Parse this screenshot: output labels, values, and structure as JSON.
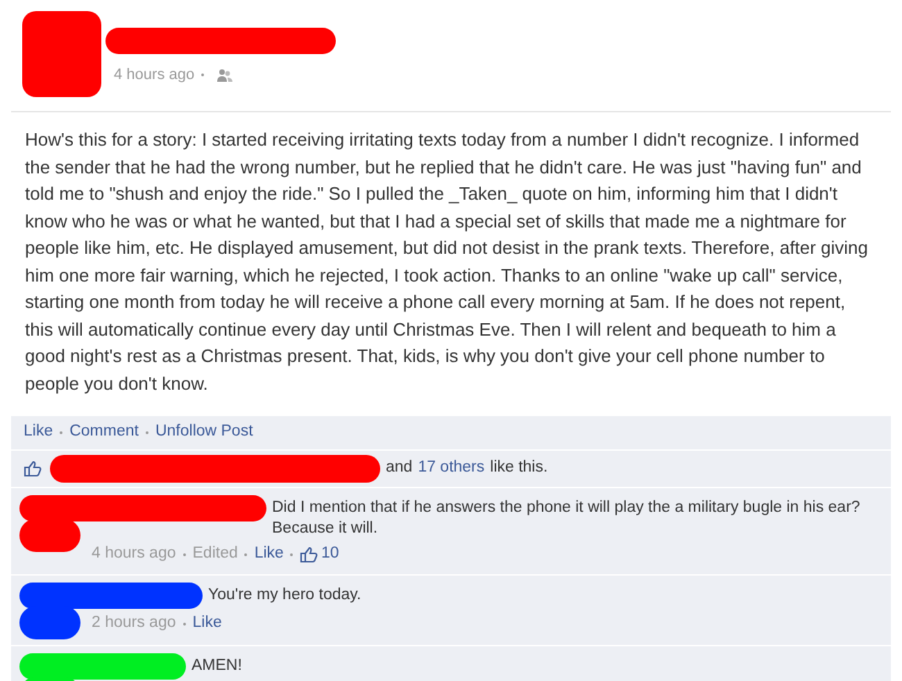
{
  "post": {
    "time": "4 hours ago",
    "text": "How's this for a story: I started receiving irritating texts today from a number I didn't recognize. I informed the sender that he had the wrong number, but he replied that he didn't care. He was just \"having fun\" and told me to \"shush and enjoy the ride.\" So I pulled the _Taken_ quote on him, informing him that I didn't know who he was or what he wanted, but that I had a special set of skills that made me a nightmare for people like him, etc. He displayed amusement, but did not desist in the prank texts. Therefore, after giving him one more fair warning, which he rejected, I took action. Thanks to an online \"wake up call\" service, starting one month from today he will receive a phone call every morning at 5am. If he does not repent, this will automatically continue every day until Christmas Eve. Then I will relent and bequeath to him a good night's rest as a Christmas present. That, kids, is why you don't give your cell phone number to people you don't know."
  },
  "actions": [
    "Like",
    "Comment",
    "Unfollow Post"
  ],
  "likes": {
    "and": "and",
    "others": "17 others",
    "suffix": "like this."
  },
  "comments": [
    {
      "color": "#ff0000",
      "text": "Did I mention that if he answers the phone it will play the a military bugle in his ear? Because it will.",
      "time": "4 hours ago",
      "edited": "Edited",
      "like": "Like",
      "like_count": "10"
    },
    {
      "color": "#0033ff",
      "text": "You're my hero today.",
      "time": "2 hours ago",
      "like": "Like"
    },
    {
      "color": "#00ee22",
      "text": "AMEN!"
    }
  ]
}
